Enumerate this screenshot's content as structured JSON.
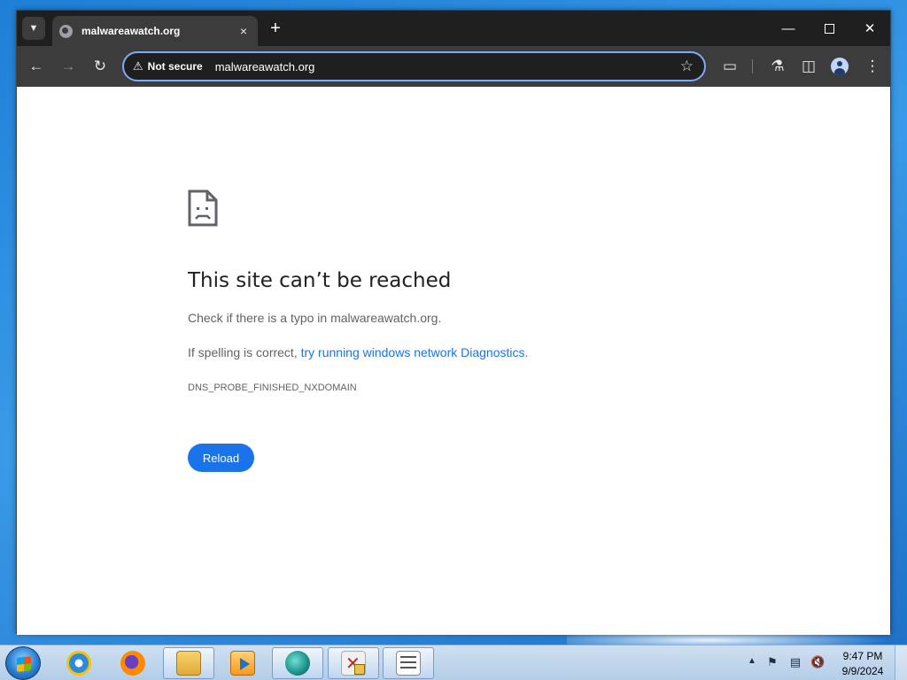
{
  "browser": {
    "tab": {
      "title": "malwareawatch.org",
      "close_glyph": "×"
    },
    "new_tab_glyph": "+",
    "security_chip": "Not secure",
    "url": "malwareawatch.org"
  },
  "error_page": {
    "title": "This site can’t be reached",
    "line1": "Check if there is a typo in malwareawatch.org.",
    "line2_prefix": "If spelling is correct, ",
    "line2_link": "try running windows network Diagnostics",
    "line2_suffix": ".",
    "code": "DNS_PROBE_FINISHED_NXDOMAIN",
    "reload_label": "Reload"
  },
  "taskbar": {
    "apps": [
      "internet-explorer",
      "firefox",
      "file-explorer",
      "media-player",
      "app-teal",
      "app-locked",
      "app-list"
    ],
    "time": "9:47 PM",
    "date": "9/9/2024"
  },
  "colors": {
    "accent": "#1a73e8",
    "omnibox_border": "#7cacf8",
    "toolbar": "#3c3c3c",
    "titlebar": "#1f1f1f"
  }
}
